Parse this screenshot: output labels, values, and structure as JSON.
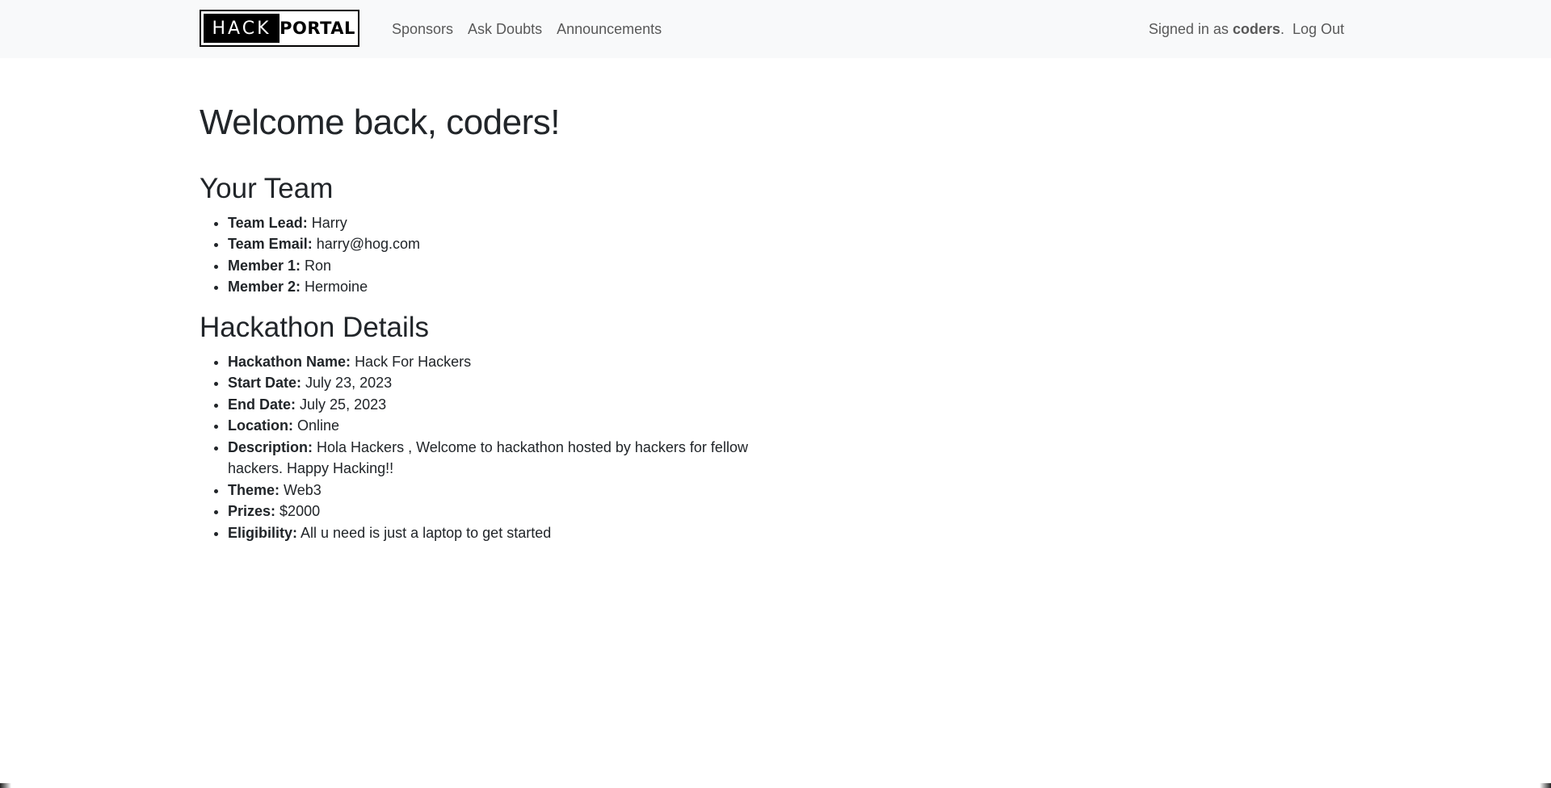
{
  "navbar": {
    "logo": {
      "left": "HACK",
      "right": "PORTAL"
    },
    "links": [
      "Sponsors",
      "Ask Doubts",
      "Announcements"
    ],
    "signed_in_prefix": "Signed in as",
    "username": "coders",
    "signed_in_suffix": ".",
    "logout": "Log Out"
  },
  "main": {
    "welcome": "Welcome back, coders!",
    "team": {
      "heading": "Your Team",
      "items": [
        {
          "label": "Team Lead:",
          "value": "Harry"
        },
        {
          "label": "Team Email:",
          "value": "harry@hog.com"
        },
        {
          "label": "Member 1:",
          "value": "Ron"
        },
        {
          "label": "Member 2:",
          "value": "Hermoine"
        }
      ]
    },
    "hackathon": {
      "heading": "Hackathon Details",
      "items": [
        {
          "label": "Hackathon Name:",
          "value": "Hack For Hackers"
        },
        {
          "label": "Start Date:",
          "value": "July 23, 2023"
        },
        {
          "label": "End Date:",
          "value": "July 25, 2023"
        },
        {
          "label": "Location:",
          "value": "Online"
        },
        {
          "label": "Description:",
          "value": "Hola Hackers , Welcome to hackathon hosted by hackers for fellow hackers. Happy Hacking!!"
        },
        {
          "label": "Theme:",
          "value": "Web3"
        },
        {
          "label": "Prizes:",
          "value": "$2000"
        },
        {
          "label": "Eligibility:",
          "value": "All u need is just a laptop to get started"
        }
      ]
    }
  }
}
